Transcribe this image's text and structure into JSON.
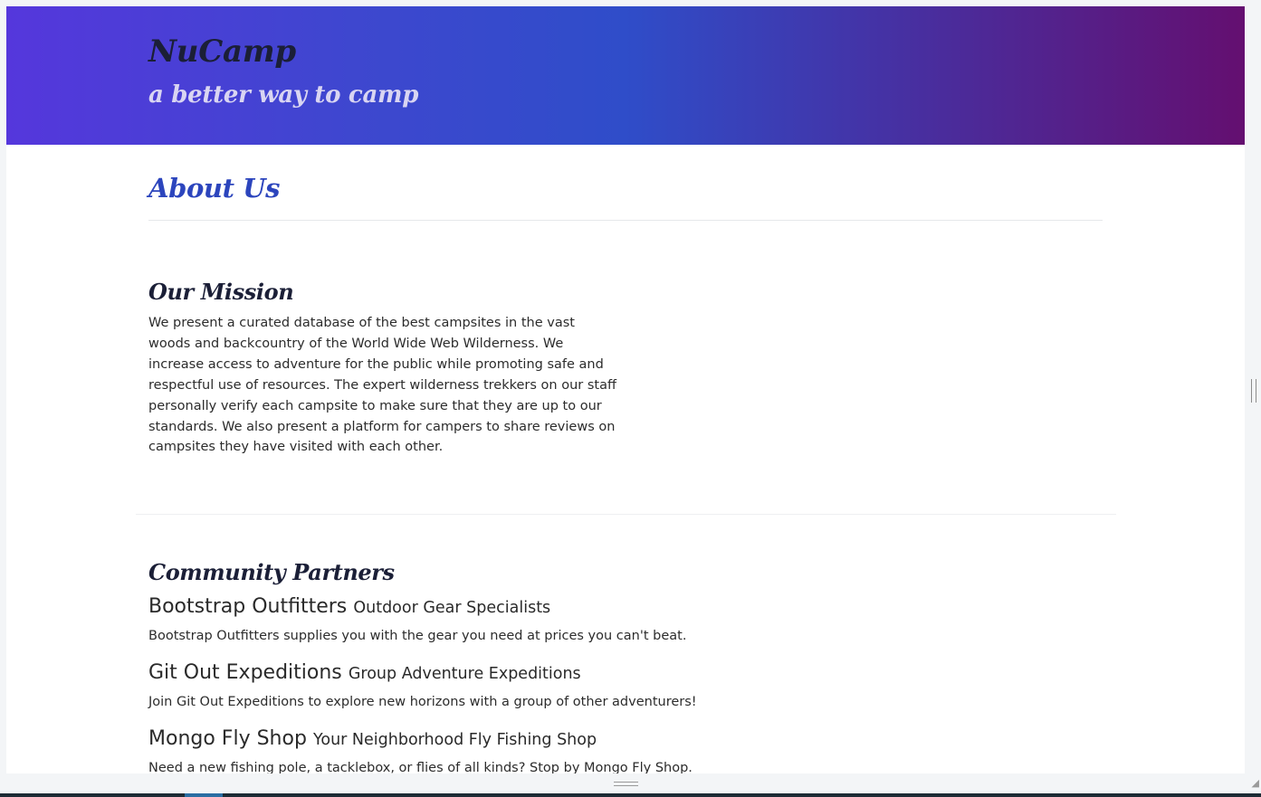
{
  "header": {
    "brand": "NuCamp",
    "tagline": "a better way to camp"
  },
  "page": {
    "heading": "About Us"
  },
  "mission": {
    "title": "Our Mission",
    "text": "We present a curated database of the best campsites in the vast woods and backcountry of the World Wide Web Wilderness. We increase access to adventure for the public while promoting safe and respectful use of resources. The expert wilderness trekkers on our staff personally verify each campsite to make sure that they are up to our standards. We also present a platform for campers to share reviews on campsites they have visited with each other."
  },
  "partners": {
    "title": "Community Partners",
    "items": [
      {
        "name": "Bootstrap Outfitters",
        "tag": "Outdoor Gear Specialists",
        "description": "Bootstrap Outfitters supplies you with the gear you need at prices you can't beat."
      },
      {
        "name": "Git Out Expeditions",
        "tag": "Group Adventure Expeditions",
        "description": "Join Git Out Expeditions to explore new horizons with a group of other adventurers!"
      },
      {
        "name": "Mongo Fly Shop",
        "tag": "Your Neighborhood Fly Fishing Shop",
        "description": "Need a new fishing pole, a tacklebox, or flies of all kinds? Stop by Mongo Fly Shop."
      }
    ]
  },
  "colors": {
    "gradient_start": "#5537dc",
    "gradient_mid": "#2f4dc9",
    "gradient_end": "#640f70",
    "heading_accent": "#2c45bd",
    "text": "#2c2c2c"
  }
}
